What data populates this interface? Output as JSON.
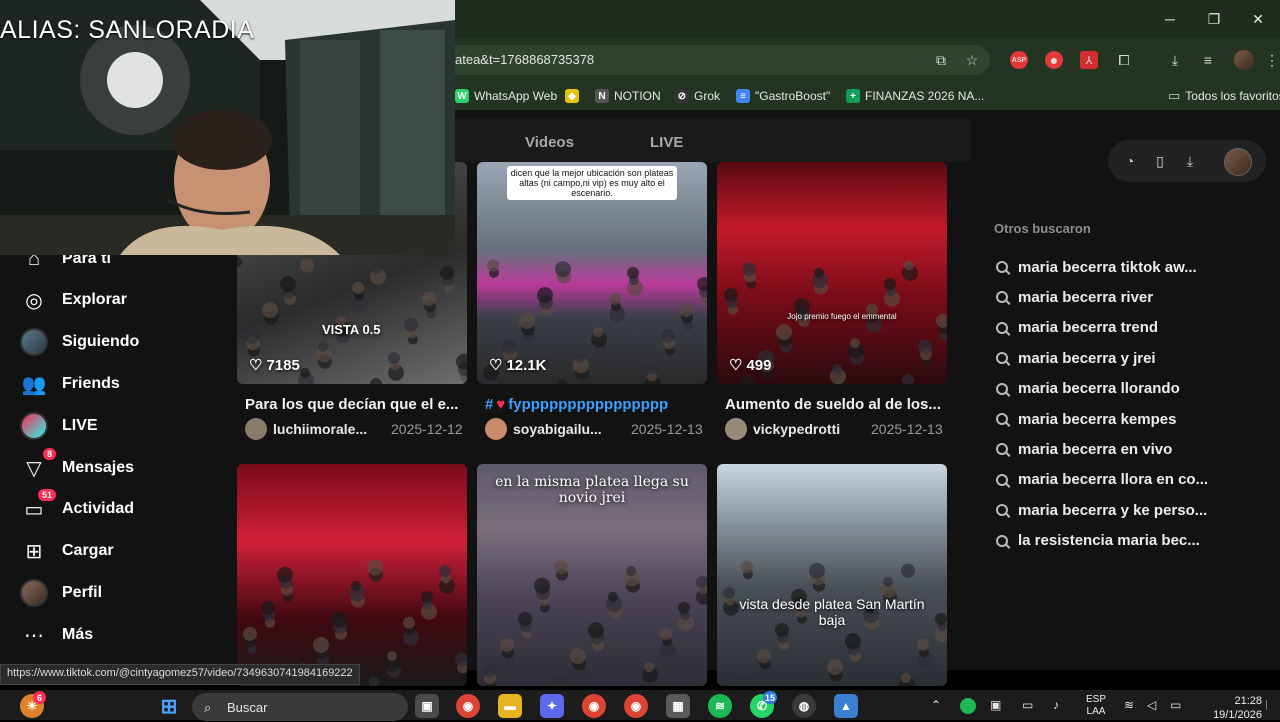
{
  "window_controls": {
    "minimize": "─",
    "restore": "❐",
    "close": "✕"
  },
  "address_bar": {
    "url": "atea&t=1768868735378"
  },
  "bookmarks": [
    {
      "label": "WhatsApp Web",
      "icon": "whatsapp-icon",
      "color": "#25d366",
      "glyph": "W"
    },
    {
      "label": "",
      "icon": "bookmark-star-icon",
      "color": "#e8c300",
      "glyph": "◆"
    },
    {
      "label": "NOTION",
      "icon": "notion-icon",
      "color": "#555555",
      "glyph": "N"
    },
    {
      "label": "Grok",
      "icon": "grok-icon",
      "color": "#333333",
      "glyph": "⊘"
    },
    {
      "label": "\"GastroBoost\"",
      "icon": "docs-icon",
      "color": "#4285f4",
      "glyph": "≡"
    },
    {
      "label": "FINANZAS 2026 NA...",
      "icon": "sheets-icon",
      "color": "#0f9d58",
      "glyph": "+"
    }
  ],
  "bookmarks_folder": "Todos los favoritos",
  "tabs": {
    "videos": "Videos",
    "live": "LIVE"
  },
  "sidebar": [
    {
      "id": "para-ti",
      "label": "Para ti",
      "icon": "home-icon",
      "glyph": "⌂",
      "badge": ""
    },
    {
      "id": "explorar",
      "label": "Explorar",
      "icon": "compass-icon",
      "glyph": "◎",
      "badge": ""
    },
    {
      "id": "siguiendo",
      "label": "Siguiendo",
      "icon": "following-avatar-icon",
      "glyph": "",
      "badge": ""
    },
    {
      "id": "friends",
      "label": "Friends",
      "icon": "friends-icon",
      "glyph": "👥",
      "badge": ""
    },
    {
      "id": "live",
      "label": "LIVE",
      "icon": "live-avatar-icon",
      "glyph": "",
      "badge": ""
    },
    {
      "id": "mensajes",
      "label": "Mensajes",
      "icon": "send-icon",
      "glyph": "▽",
      "badge": "8"
    },
    {
      "id": "actividad",
      "label": "Actividad",
      "icon": "activity-icon",
      "glyph": "▭",
      "badge": "51"
    },
    {
      "id": "cargar",
      "label": "Cargar",
      "icon": "upload-icon",
      "glyph": "⊞",
      "badge": ""
    },
    {
      "id": "perfil",
      "label": "Perfil",
      "icon": "profile-avatar-icon",
      "glyph": "",
      "badge": ""
    },
    {
      "id": "mas",
      "label": "Más",
      "icon": "more-icon",
      "glyph": "⋯",
      "badge": ""
    }
  ],
  "videos": [
    {
      "likes": "7185",
      "overlay": "VISTA 0.5",
      "title": "Para los que decían que el e...",
      "user": "luchiimorale...",
      "date": "2025-12-12",
      "bg": "linear-gradient(160deg,#5a5a5a,#2b2b2b 55%,#6e6e6e)",
      "avatar": "#8a7a6a"
    },
    {
      "likes": "12.1K",
      "overlay": "dicen que la mejor ubicación son plateas altas (ni campo,ni vip) es muy alto el escenario.",
      "title": "fypppppppppppppppp",
      "hashtag": "#",
      "user": "soyabigailu...",
      "date": "2025-12-13",
      "bg": "linear-gradient(180deg,#9aa6b4,#66707c 40%,#ba3a9a 55%,#3a3f48 70%,#2a2a2a)",
      "avatar": "#c98a6a"
    },
    {
      "likes": "499",
      "overlay": "Jojo premio fuego el emmental",
      "title": "Aumento de sueldo al de los...",
      "user": "vickypedrotti",
      "date": "2025-12-13",
      "bg": "linear-gradient(180deg,#5a0a12,#c21a2a 30%,#7a0c18 60%,#2a0a0e)",
      "avatar": "#9a8a7a"
    },
    {
      "likes": "",
      "overlay": "",
      "title": "",
      "user": "",
      "date": "",
      "bg": "linear-gradient(180deg,#7a0a18,#d0203a 35%,#400810 70%,#1a1a1a)",
      "avatar": ""
    },
    {
      "likes": "",
      "overlay": "en la misma platea llega su novio jrei",
      "title": "",
      "user": "",
      "date": "",
      "bg": "linear-gradient(180deg,#5e5a6a,#7a6e7e 30%,#4a4456 60%,#2e2c36)",
      "avatar": ""
    },
    {
      "likes": "",
      "overlay": "vista desde platea San Martín baja",
      "title": "",
      "user": "",
      "date": "",
      "bg": "linear-gradient(180deg,#c8d4de,#8a96a0 25%,#4a5058 55%,#2a2e34)",
      "avatar": ""
    }
  ],
  "others_searched": {
    "title": "Otros buscaron",
    "items": [
      "maria becerra tiktok aw...",
      "maria becerra river",
      "maria becerra trend",
      "maria becerra y jrei",
      "maria becerra llorando",
      "maria becerra kempes",
      "maria becerra en vivo",
      "maria becerra llora en co...",
      "maria becerra y ke perso...",
      "la resistencia maria bec..."
    ]
  },
  "webcam": {
    "alias": "ALIAS: SANLORADIA"
  },
  "status_link": "https://www.tiktok.com/@cintyagomez57/video/7349630741984169222",
  "taskbar": {
    "search_label": "Buscar",
    "lang_top": "ESP",
    "lang_bottom": "LAA",
    "time": "21:28",
    "date": "19/1/2026",
    "widget_badge": "6",
    "whatsapp_badge": "15"
  },
  "colors": {
    "accent": "#fe2c55",
    "link": "#3aa0ff",
    "browser_frame": "#233423"
  }
}
